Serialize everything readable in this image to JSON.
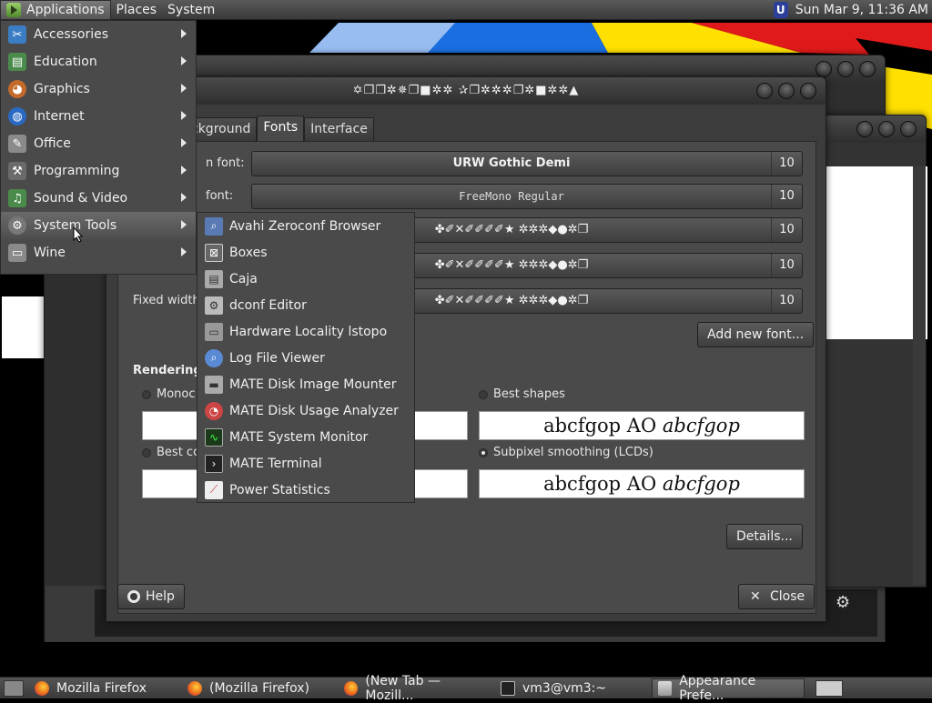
{
  "top_panel": {
    "menus": [
      "Applications",
      "Places",
      "System"
    ],
    "tray_icon_letter": "U",
    "clock": "Sun Mar  9, 11:36 AM"
  },
  "applications_menu": {
    "items": [
      {
        "label": "Accessories",
        "icon": "accessories-icon",
        "color": "#3b7dc4"
      },
      {
        "label": "Education",
        "icon": "education-icon",
        "color": "#4a8a4a"
      },
      {
        "label": "Graphics",
        "icon": "graphics-icon",
        "color": "#c46a2a"
      },
      {
        "label": "Internet",
        "icon": "internet-icon",
        "color": "#2a6ac4"
      },
      {
        "label": "Office",
        "icon": "office-icon",
        "color": "#8a8a8a"
      },
      {
        "label": "Programming",
        "icon": "programming-icon",
        "color": "#6a6a6a"
      },
      {
        "label": "Sound & Video",
        "icon": "sound-video-icon",
        "color": "#4a8a4a"
      },
      {
        "label": "System Tools",
        "icon": "system-tools-icon",
        "color": "#777777"
      },
      {
        "label": "Wine",
        "icon": "wine-icon",
        "color": "#8a8a8a"
      }
    ]
  },
  "system_tools_menu": {
    "items": [
      {
        "label": "Avahi Zeroconf Browser",
        "icon": "avahi-icon"
      },
      {
        "label": "Boxes",
        "icon": "boxes-icon"
      },
      {
        "label": "Caja",
        "icon": "caja-icon"
      },
      {
        "label": "dconf Editor",
        "icon": "dconf-icon"
      },
      {
        "label": "Hardware Locality lstopo",
        "icon": "hwloc-icon"
      },
      {
        "label": "Log File Viewer",
        "icon": "log-viewer-icon"
      },
      {
        "label": "MATE Disk Image Mounter",
        "icon": "disk-mounter-icon"
      },
      {
        "label": "MATE Disk Usage Analyzer",
        "icon": "disk-usage-icon"
      },
      {
        "label": "MATE System Monitor",
        "icon": "system-monitor-icon"
      },
      {
        "label": "MATE Terminal",
        "icon": "terminal-icon"
      },
      {
        "label": "Power Statistics",
        "icon": "power-stats-icon"
      }
    ]
  },
  "appearance_window": {
    "title": "✡❐❐✲✵❐■✲✲ ✰❐✲✲✲❐✲■✲✲▲",
    "tabs": [
      "ckground",
      "Fonts",
      "Interface"
    ],
    "active_tab": "Fonts",
    "font_rows": [
      {
        "label": "n font:",
        "font": "URW Gothic Demi",
        "size": "10"
      },
      {
        "label": " font:",
        "font": "FreeMono Regular",
        "size": "10"
      },
      {
        "label": "",
        "font": "✤✐✕✐✐✐✐★ ✲✲✲◆●✲❐",
        "size": "10"
      },
      {
        "label": "",
        "font": "✤✐✕✐✐✐✐★ ✲✲✲◆●✲❐",
        "size": "10"
      },
      {
        "label": "Fixed width",
        "font": "✤✐✕✐✐✐✐★ ✲✲✲◆●✲❐",
        "size": "10"
      }
    ],
    "add_font_button": "Add new font...",
    "rendering_title": "Rendering",
    "rendering_options": {
      "mono": "Monoc",
      "best_shapes": "Best shapes",
      "best_contrast": "Best co",
      "subpixel": "Subpixel smoothing (LCDs)"
    },
    "preview_text": "abcfgop AO ",
    "preview_italic": "abcfgop",
    "details_button": "Details...",
    "help_button": "Help",
    "close_button": "Close"
  },
  "taskbar": {
    "tasks": [
      {
        "label": "Mozilla Firefox",
        "icon": "firefox-icon"
      },
      {
        "label": "(Mozilla Firefox)",
        "icon": "firefox-icon"
      },
      {
        "label": "(New Tab — Mozill...",
        "icon": "firefox-icon"
      },
      {
        "label": "vm3@vm3:~",
        "icon": "terminal-icon"
      },
      {
        "label": "Appearance Prefe...",
        "icon": "appearance-icon"
      }
    ]
  }
}
